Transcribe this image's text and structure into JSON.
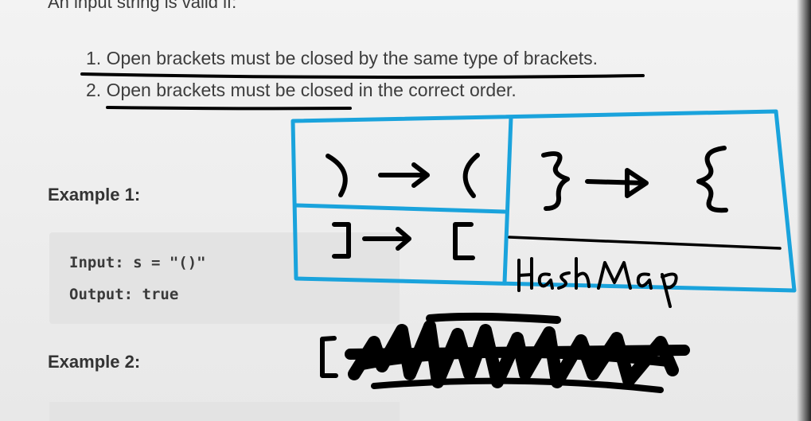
{
  "intro": "An input string is valid if:",
  "rules": [
    {
      "number": "1.",
      "text": "Open brackets must be closed by the same type of brackets."
    },
    {
      "number": "2.",
      "text": "Open brackets must be closed in the correct order."
    }
  ],
  "example1": {
    "heading": "Example 1:",
    "input_label": "Input:",
    "input_value": "s = \"()\"",
    "output_label": "Output:",
    "output_value": "true"
  },
  "example2": {
    "heading": "Example 2:"
  },
  "annotation": {
    "title": "HashMap",
    "mappings": [
      {
        "from": ")",
        "to": "("
      },
      {
        "from": "}",
        "to": "{"
      },
      {
        "from": "]",
        "to": "["
      }
    ],
    "box_color": "#1aa3dc",
    "ink_color": "#000000"
  }
}
